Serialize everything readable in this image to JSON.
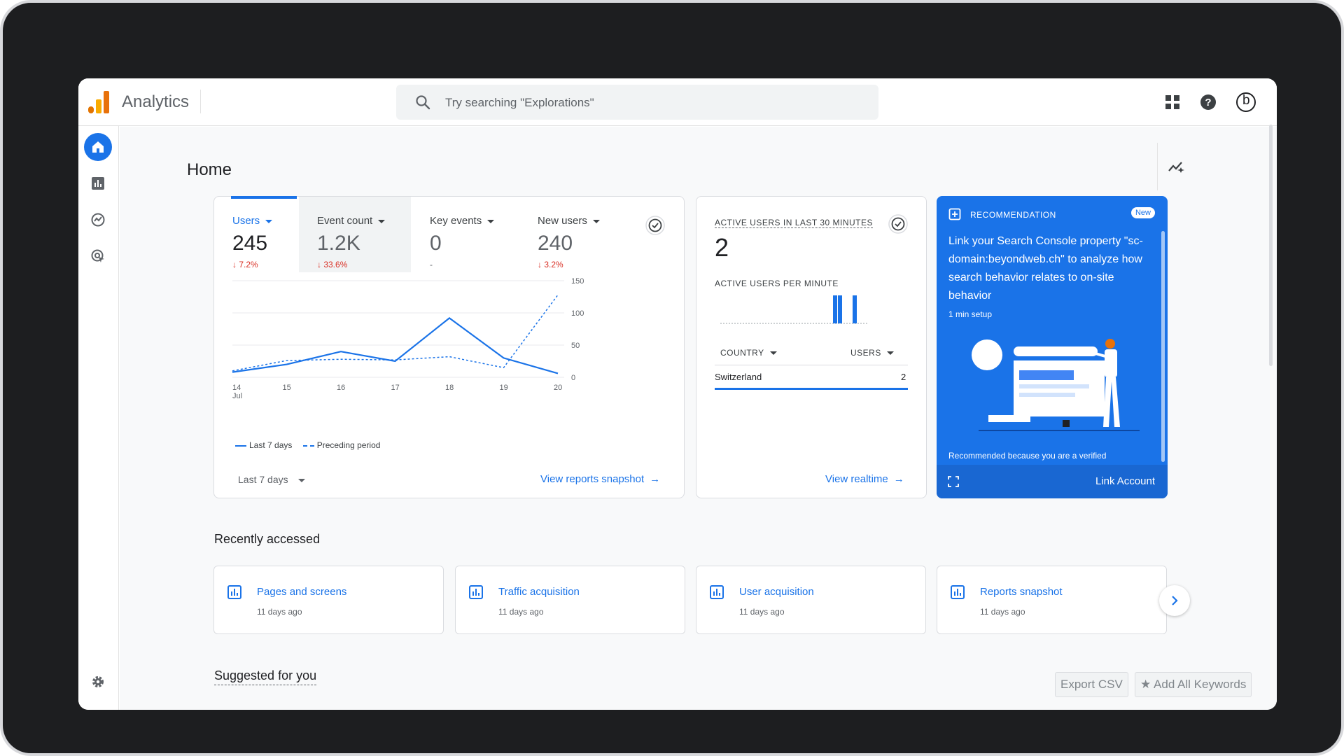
{
  "header": {
    "app_title": "Analytics",
    "search_placeholder": "Try searching \"Explorations\"",
    "avatar_letter": "b"
  },
  "page": {
    "title": "Home"
  },
  "metrics": [
    {
      "label": "Users",
      "value": "245",
      "delta": "↓ 7.2%"
    },
    {
      "label": "Event count",
      "value": "1.2K",
      "delta": "↓ 33.6%"
    },
    {
      "label": "Key events",
      "value": "0",
      "delta": "-"
    },
    {
      "label": "New users",
      "value": "240",
      "delta": "↓ 3.2%"
    }
  ],
  "chart_data": {
    "type": "line",
    "x": [
      "14",
      "15",
      "16",
      "17",
      "18",
      "19",
      "20"
    ],
    "x_sublabel_first": "Jul",
    "series": [
      {
        "name": "Last 7 days",
        "style": "solid",
        "values": [
          8,
          20,
          40,
          25,
          92,
          30,
          6
        ]
      },
      {
        "name": "Preceding period",
        "style": "dashed",
        "values": [
          10,
          26,
          28,
          27,
          32,
          15,
          128
        ]
      }
    ],
    "y_ticks": [
      "150",
      "100",
      "50",
      "0"
    ],
    "ylim": [
      0,
      150
    ],
    "grid": true,
    "legend": "bottom-left"
  },
  "metric_card": {
    "period_label": "Last 7 days",
    "link_label": "View reports snapshot"
  },
  "realtime": {
    "title": "ACTIVE USERS IN LAST 30 MINUTES",
    "count": "2",
    "per_minute_label": "ACTIVE USERS PER MINUTE",
    "per_minute_values": [
      0,
      0,
      0,
      0,
      0,
      0,
      0,
      0,
      0,
      0,
      0,
      0,
      0,
      0,
      0,
      0,
      0,
      0,
      0,
      0,
      0,
      0,
      0,
      1,
      1,
      0,
      0,
      1,
      0,
      0
    ],
    "country_header": "COUNTRY",
    "users_header": "USERS",
    "rows": [
      {
        "country": "Switzerland",
        "users": "2"
      }
    ],
    "link_label": "View realtime"
  },
  "recommendation": {
    "header": "RECOMMENDATION",
    "badge": "New",
    "body": "Link your Search Console property \"sc-domain:beyondweb.ch\" to analyze how search behavior relates to on-site behavior",
    "setup": "1 min setup",
    "reason": "Recommended because you are a verified",
    "action": "Link Account"
  },
  "recent": {
    "title": "Recently accessed",
    "items": [
      {
        "title": "Pages and screens",
        "sub": "11 days ago"
      },
      {
        "title": "Traffic acquisition",
        "sub": "11 days ago"
      },
      {
        "title": "User acquisition",
        "sub": "11 days ago"
      },
      {
        "title": "Reports snapshot",
        "sub": "11 days ago"
      }
    ]
  },
  "suggested": {
    "title": "Suggested for you"
  },
  "overlay_buttons": {
    "export": "Export CSV",
    "add_keywords": "★ Add All Keywords"
  },
  "colors": {
    "accent": "#1a73e8",
    "negative": "#d93025",
    "frame": "#1d1e20"
  }
}
